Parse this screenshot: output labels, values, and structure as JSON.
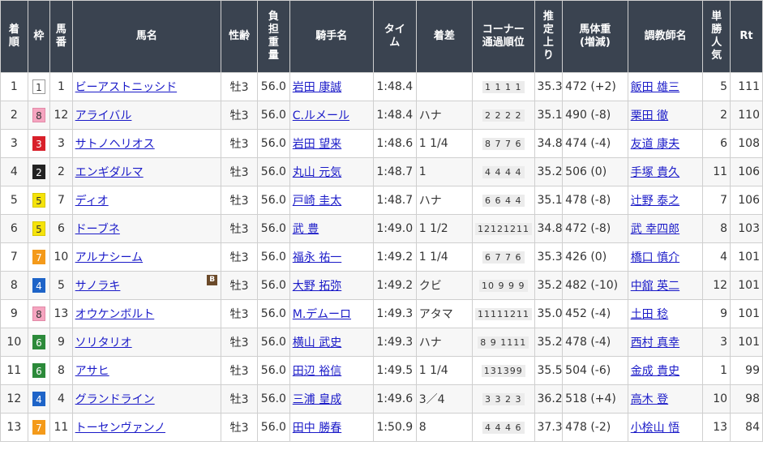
{
  "headers": {
    "rank": [
      "着",
      "順"
    ],
    "waku": "枠",
    "umaban": [
      "馬",
      "番"
    ],
    "horse": "馬名",
    "sexage": "性齢",
    "weight": [
      "負",
      "担",
      "重",
      "量"
    ],
    "jockey": "騎手名",
    "time": [
      "タイ",
      "ム"
    ],
    "margin": "着差",
    "corner": [
      "コーナー",
      "通過順位"
    ],
    "last3f": [
      "推",
      "定",
      "上",
      "り"
    ],
    "bodyweight": [
      "馬体重",
      "(増減)"
    ],
    "trainer": "調教師名",
    "pop": [
      "単",
      "勝",
      "人",
      "気"
    ],
    "rt": "Rt"
  },
  "rows": [
    {
      "rank": "1",
      "waku": "1",
      "umaban": "1",
      "horse": "ビーアストニッシド",
      "blinker": "",
      "sexage": "牡3",
      "weight": "56.0",
      "jockey": "岩田 康誠",
      "time": "1:48.4",
      "margin": "",
      "corner": "1 1 1 1",
      "last3f": "35.3",
      "bodyweight": "472 (+2)",
      "trainer": "飯田 雄三",
      "pop": "5",
      "rt": "111"
    },
    {
      "rank": "2",
      "waku": "8",
      "umaban": "12",
      "horse": "アライバル",
      "blinker": "",
      "sexage": "牡3",
      "weight": "56.0",
      "jockey": "C.ルメール",
      "time": "1:48.4",
      "margin": "ハナ",
      "corner": "2 2 2 2",
      "last3f": "35.1",
      "bodyweight": "490 (-8)",
      "trainer": "栗田 徹",
      "pop": "2",
      "rt": "110"
    },
    {
      "rank": "3",
      "waku": "3",
      "umaban": "3",
      "horse": "サトノヘリオス",
      "blinker": "",
      "sexage": "牡3",
      "weight": "56.0",
      "jockey": "岩田 望来",
      "time": "1:48.6",
      "margin": "1 1/4",
      "corner": "8 7 7 6",
      "last3f": "34.8",
      "bodyweight": "474 (-4)",
      "trainer": "友道 康夫",
      "pop": "6",
      "rt": "108"
    },
    {
      "rank": "4",
      "waku": "2",
      "umaban": "2",
      "horse": "エンギダルマ",
      "blinker": "",
      "sexage": "牡3",
      "weight": "56.0",
      "jockey": "丸山 元気",
      "time": "1:48.7",
      "margin": "1",
      "corner": "4 4 4 4",
      "last3f": "35.2",
      "bodyweight": "506 (0)",
      "trainer": "手塚 貴久",
      "pop": "11",
      "rt": "106"
    },
    {
      "rank": "5",
      "waku": "5",
      "umaban": "7",
      "horse": "ディオ",
      "blinker": "",
      "sexage": "牡3",
      "weight": "56.0",
      "jockey": "戸崎 圭太",
      "time": "1:48.7",
      "margin": "ハナ",
      "corner": "6 6 4 4",
      "last3f": "35.1",
      "bodyweight": "478 (-8)",
      "trainer": "辻野 泰之",
      "pop": "7",
      "rt": "106"
    },
    {
      "rank": "6",
      "waku": "5",
      "umaban": "6",
      "horse": "ドーブネ",
      "blinker": "",
      "sexage": "牡3",
      "weight": "56.0",
      "jockey": "武 豊",
      "time": "1:49.0",
      "margin": "1 1/2",
      "corner": "12121211",
      "last3f": "34.8",
      "bodyweight": "472 (-8)",
      "trainer": "武 幸四郎",
      "pop": "8",
      "rt": "103"
    },
    {
      "rank": "7",
      "waku": "7",
      "umaban": "10",
      "horse": "アルナシーム",
      "blinker": "",
      "sexage": "牡3",
      "weight": "56.0",
      "jockey": "福永 祐一",
      "time": "1:49.2",
      "margin": "1 1/4",
      "corner": "6 7 7 6",
      "last3f": "35.3",
      "bodyweight": "426 (0)",
      "trainer": "橋口 慎介",
      "pop": "4",
      "rt": "101"
    },
    {
      "rank": "8",
      "waku": "4",
      "umaban": "5",
      "horse": "サノラキ",
      "blinker": "B",
      "sexage": "牡3",
      "weight": "56.0",
      "jockey": "大野 拓弥",
      "time": "1:49.2",
      "margin": "クビ",
      "corner": "10 9 9 9",
      "last3f": "35.2",
      "bodyweight": "482 (-10)",
      "trainer": "中舘 英二",
      "pop": "12",
      "rt": "101"
    },
    {
      "rank": "9",
      "waku": "8",
      "umaban": "13",
      "horse": "オウケンボルト",
      "blinker": "",
      "sexage": "牡3",
      "weight": "56.0",
      "jockey": "M.デムーロ",
      "time": "1:49.3",
      "margin": "アタマ",
      "corner": "11111211",
      "last3f": "35.0",
      "bodyweight": "452 (-4)",
      "trainer": "土田 稔",
      "pop": "9",
      "rt": "101"
    },
    {
      "rank": "10",
      "waku": "6",
      "umaban": "9",
      "horse": "ソリタリオ",
      "blinker": "",
      "sexage": "牡3",
      "weight": "56.0",
      "jockey": "横山 武史",
      "time": "1:49.3",
      "margin": "ハナ",
      "corner": "8 9 1111",
      "last3f": "35.2",
      "bodyweight": "478 (-4)",
      "trainer": "西村 真幸",
      "pop": "3",
      "rt": "101"
    },
    {
      "rank": "11",
      "waku": "6",
      "umaban": "8",
      "horse": "アサヒ",
      "blinker": "",
      "sexage": "牡3",
      "weight": "56.0",
      "jockey": "田辺 裕信",
      "time": "1:49.5",
      "margin": "1 1/4",
      "corner": "131399",
      "last3f": "35.5",
      "bodyweight": "504 (-6)",
      "trainer": "金成 貴史",
      "pop": "1",
      "rt": "99"
    },
    {
      "rank": "12",
      "waku": "4",
      "umaban": "4",
      "horse": "グランドライン",
      "blinker": "",
      "sexage": "牡3",
      "weight": "56.0",
      "jockey": "三浦 皇成",
      "time": "1:49.6",
      "margin": "3／4",
      "corner": "3 3 2 3",
      "last3f": "36.2",
      "bodyweight": "518 (+4)",
      "trainer": "高木 登",
      "pop": "10",
      "rt": "98"
    },
    {
      "rank": "13",
      "waku": "7",
      "umaban": "11",
      "horse": "トーセンヴァンノ",
      "blinker": "",
      "sexage": "牡3",
      "weight": "56.0",
      "jockey": "田中 勝春",
      "time": "1:50.9",
      "margin": "8",
      "corner": "4 4 4 6",
      "last3f": "37.3",
      "bodyweight": "478 (-2)",
      "trainer": "小桧山 悟",
      "pop": "13",
      "rt": "84"
    }
  ]
}
